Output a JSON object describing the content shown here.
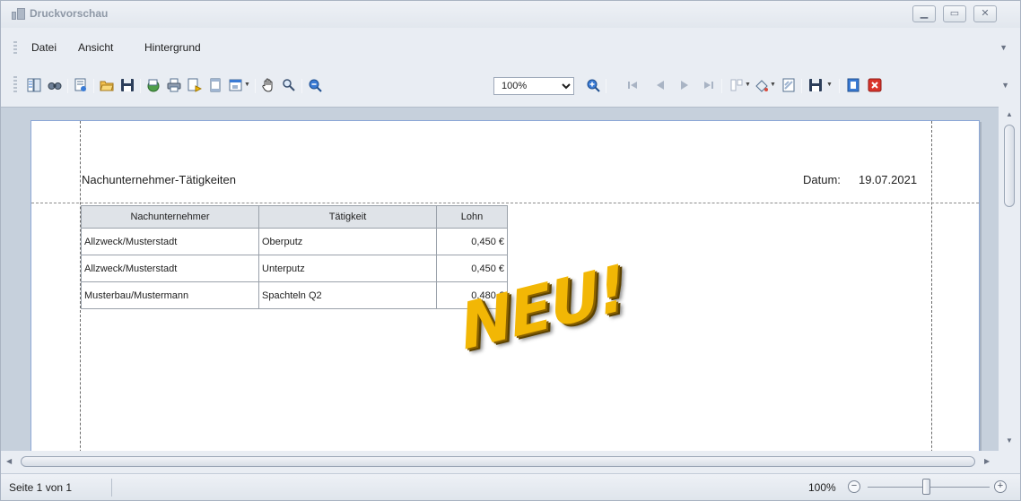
{
  "window": {
    "title": "Druckvorschau"
  },
  "menu": {
    "items": [
      "Datei",
      "Ansicht",
      "Hintergrund"
    ]
  },
  "toolbar": {
    "zoom_value": "100%",
    "icons": [
      "document-map-icon",
      "search-icon",
      "parameters-icon",
      "open-icon",
      "save-icon",
      "page-setup-icon",
      "print-icon",
      "quick-print-icon",
      "header-footer-icon",
      "scale-icon",
      "hand-tool-icon",
      "magnifier-icon",
      "zoom-out-icon",
      "zoom-in-icon",
      "first-page-icon",
      "previous-page-icon",
      "next-page-icon",
      "last-page-icon",
      "multiple-pages-icon",
      "page-color-icon",
      "watermark-icon",
      "export-icon",
      "send-icon",
      "close-preview-icon"
    ]
  },
  "report": {
    "title": "Nachunternehmer-Tätigkeiten",
    "date_label": "Datum:",
    "date_value": "19.07.2021",
    "columns": [
      "Nachunternehmer",
      "Tätigkeit",
      "Lohn"
    ],
    "rows": [
      [
        "Allzweck/Musterstadt",
        "Oberputz",
        "0,450 €"
      ],
      [
        "Allzweck/Musterstadt",
        "Unterputz",
        "0,450 €"
      ],
      [
        "Musterbau/Mustermann",
        "Spachteln Q2",
        "0,480 €"
      ]
    ],
    "stamp": "NEU!"
  },
  "status": {
    "page_info": "Seite 1 von 1",
    "zoom": "100%",
    "zoom_level": 0.5
  }
}
